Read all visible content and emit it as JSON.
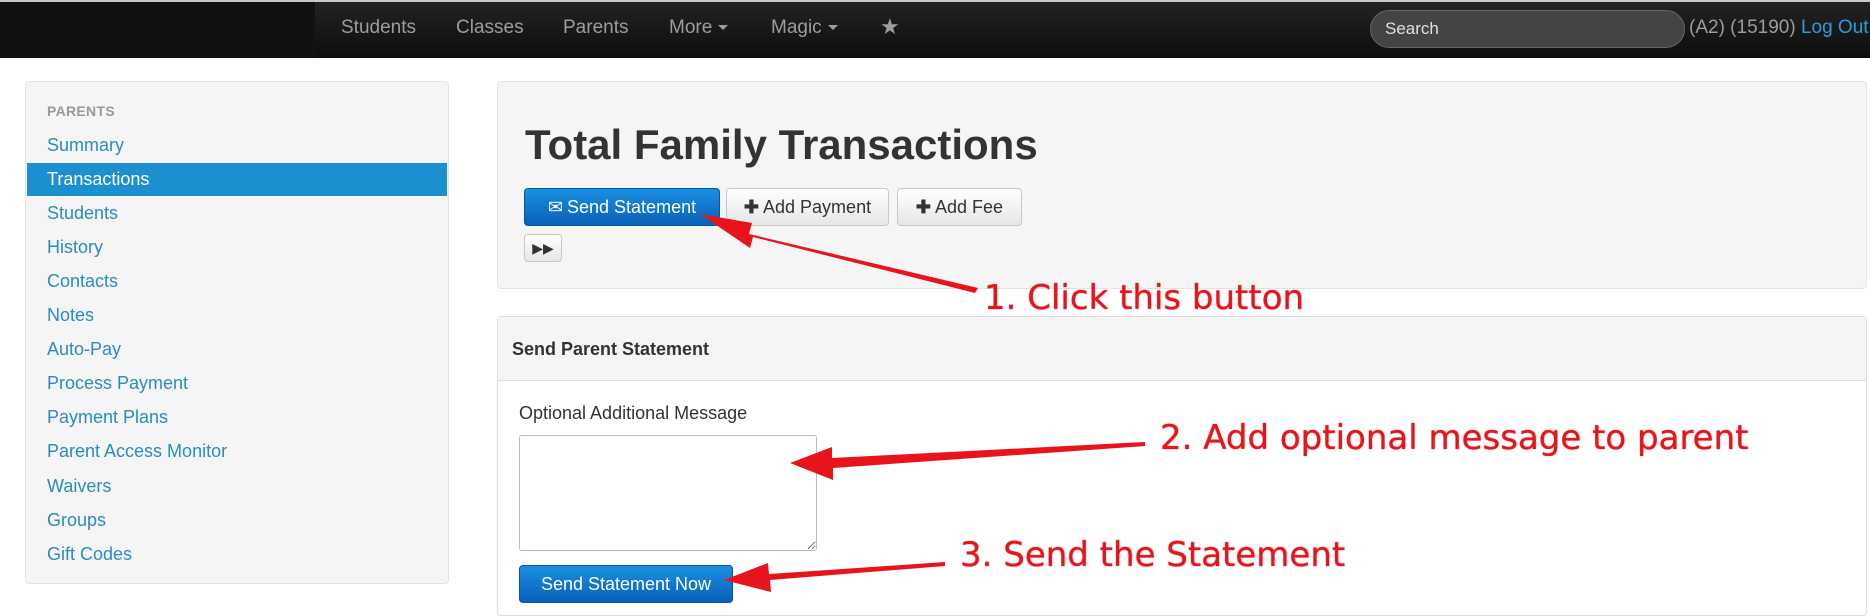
{
  "nav": {
    "items": [
      {
        "label": "Students"
      },
      {
        "label": "Classes"
      },
      {
        "label": "Parents"
      },
      {
        "label": "More"
      },
      {
        "label": "Magic"
      }
    ],
    "star_icon": "star-icon",
    "search_placeholder": "Search",
    "user_info": "(A2) (15190)",
    "logout_label": "Log Out"
  },
  "sidebar": {
    "heading": "PARENTS",
    "items": [
      {
        "label": "Summary"
      },
      {
        "label": "Transactions",
        "active": true
      },
      {
        "label": "Students"
      },
      {
        "label": "History"
      },
      {
        "label": "Contacts"
      },
      {
        "label": "Notes"
      },
      {
        "label": "Auto-Pay"
      },
      {
        "label": "Process Payment"
      },
      {
        "label": "Payment Plans"
      },
      {
        "label": "Parent Access Monitor"
      },
      {
        "label": "Waivers"
      },
      {
        "label": "Groups"
      },
      {
        "label": "Gift Codes"
      }
    ]
  },
  "main": {
    "title": "Total Family Transactions",
    "buttons": {
      "send_statement": "Send Statement",
      "add_payment": "Add Payment",
      "add_fee": "Add Fee"
    },
    "icons": {
      "send_statement": "envelope-icon",
      "add_payment": "plus-icon",
      "add_fee": "plus-icon",
      "forward": "fast-forward-icon"
    }
  },
  "panel": {
    "title": "Send Parent Statement",
    "message_label": "Optional Additional Message",
    "message_value": "",
    "send_now_label": "Send Statement Now"
  },
  "annotations": {
    "step1": "1. Click this button",
    "step2": "2. Add optional message to parent",
    "step3": "3. Send the Statement",
    "color": "#e8141b"
  },
  "colors": {
    "link": "#2a8bc0",
    "active_bg": "#1c8fd0",
    "primary_button": "#0761b8",
    "navbar": "#1a1a1a"
  }
}
